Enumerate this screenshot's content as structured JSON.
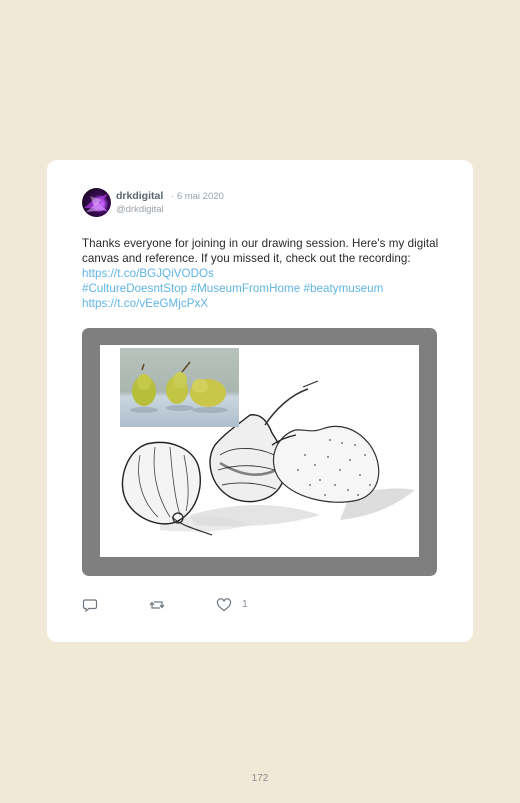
{
  "tweet": {
    "author_name": "drkdigital",
    "date": "6 mai 2020",
    "handle": "@drkdigital",
    "text_plain": "Thanks everyone for joining in our drawing session. Here's my digital canvas and reference. If you missed it, check out the recording: ",
    "link_1": "https://t.co/BGJQiVODOs",
    "hashtag_1": "#CultureDoesntStop",
    "hashtag_2": "#MuseumFromHome",
    "hashtag_3": "#beatymuseum",
    "link_2": "https://t.co/vEeGMjcPxX",
    "like_count": "1",
    "icons": [
      "reply-icon",
      "retweet-icon",
      "like-icon"
    ]
  },
  "page": {
    "number": "172"
  },
  "colors": {
    "background": "#f0e9d8",
    "link": "#5fb4e6",
    "card": "#ffffff",
    "media_frame": "#7f7f7f"
  }
}
